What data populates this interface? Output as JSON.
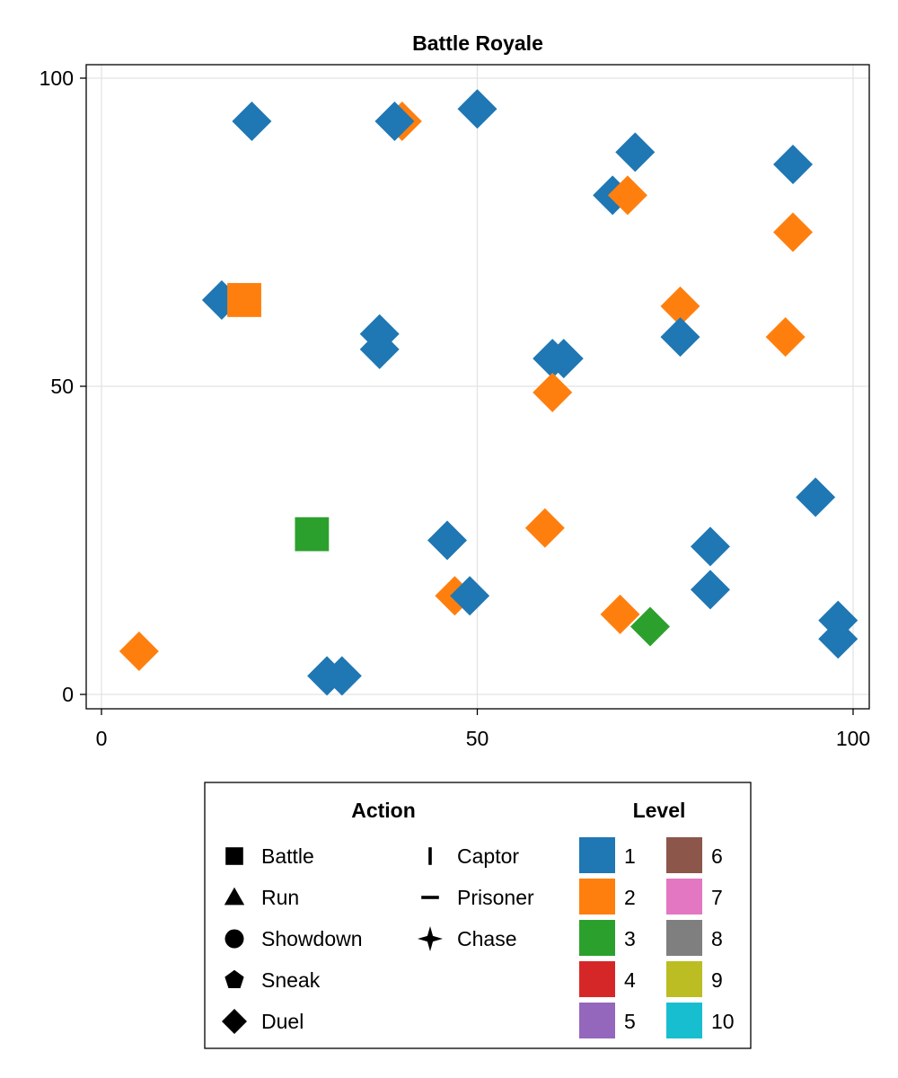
{
  "chart_data": {
    "type": "scatter",
    "title": "Battle Royale",
    "xlabel": "",
    "ylabel": "",
    "xlim": [
      -2,
      102
    ],
    "ylim": [
      -2.5,
      102
    ],
    "xticks": [
      0,
      50,
      100
    ],
    "yticks": [
      0,
      50,
      100
    ],
    "grid": true,
    "legend_placement": "bottom",
    "level_colors": {
      "1": "#1f77b4",
      "2": "#ff7f0e",
      "3": "#2ca02c",
      "4": "#d62728",
      "5": "#9467bd",
      "6": "#8c564b",
      "7": "#e377c2",
      "8": "#7f7f7f",
      "9": "#bcbd22",
      "10": "#17becf"
    },
    "points": [
      {
        "x": 40,
        "y": 93,
        "level": 2,
        "action": "Duel"
      },
      {
        "x": 20,
        "y": 93,
        "level": 1,
        "action": "Duel"
      },
      {
        "x": 39,
        "y": 93,
        "level": 1,
        "action": "Duel"
      },
      {
        "x": 50,
        "y": 95,
        "level": 1,
        "action": "Duel"
      },
      {
        "x": 71,
        "y": 88,
        "level": 1,
        "action": "Duel"
      },
      {
        "x": 92,
        "y": 86,
        "level": 1,
        "action": "Duel"
      },
      {
        "x": 68,
        "y": 81,
        "level": 1,
        "action": "Duel"
      },
      {
        "x": 70,
        "y": 81,
        "level": 2,
        "action": "Duel"
      },
      {
        "x": 92,
        "y": 75,
        "level": 2,
        "action": "Duel"
      },
      {
        "x": 16,
        "y": 64,
        "level": 1,
        "action": "Duel"
      },
      {
        "x": 19,
        "y": 64,
        "level": 2,
        "action": "Battle"
      },
      {
        "x": 37,
        "y": 58.5,
        "level": 1,
        "action": "Duel"
      },
      {
        "x": 37,
        "y": 56,
        "level": 1,
        "action": "Duel"
      },
      {
        "x": 77,
        "y": 63,
        "level": 2,
        "action": "Duel"
      },
      {
        "x": 77,
        "y": 58,
        "level": 1,
        "action": "Duel"
      },
      {
        "x": 91,
        "y": 58,
        "level": 2,
        "action": "Duel"
      },
      {
        "x": 61.5,
        "y": 54.5,
        "level": 1,
        "action": "Duel"
      },
      {
        "x": 60,
        "y": 54.5,
        "level": 1,
        "action": "Duel"
      },
      {
        "x": 60,
        "y": 49,
        "level": 2,
        "action": "Duel"
      },
      {
        "x": 95,
        "y": 32,
        "level": 1,
        "action": "Duel"
      },
      {
        "x": 28,
        "y": 26,
        "level": 3,
        "action": "Battle"
      },
      {
        "x": 59,
        "y": 27,
        "level": 2,
        "action": "Duel"
      },
      {
        "x": 46,
        "y": 25,
        "level": 1,
        "action": "Duel"
      },
      {
        "x": 81,
        "y": 24,
        "level": 1,
        "action": "Duel"
      },
      {
        "x": 47,
        "y": 16,
        "level": 2,
        "action": "Duel"
      },
      {
        "x": 49,
        "y": 16,
        "level": 1,
        "action": "Duel"
      },
      {
        "x": 81,
        "y": 17,
        "level": 1,
        "action": "Duel"
      },
      {
        "x": 69,
        "y": 13,
        "level": 2,
        "action": "Duel"
      },
      {
        "x": 73,
        "y": 11,
        "level": 3,
        "action": "Duel"
      },
      {
        "x": 98,
        "y": 12,
        "level": 1,
        "action": "Duel"
      },
      {
        "x": 98,
        "y": 9,
        "level": 1,
        "action": "Duel"
      },
      {
        "x": 5,
        "y": 7,
        "level": 2,
        "action": "Duel"
      },
      {
        "x": 30,
        "y": 3,
        "level": 1,
        "action": "Duel"
      },
      {
        "x": 32,
        "y": 3,
        "level": 1,
        "action": "Duel"
      }
    ],
    "legend": {
      "action_title": "Action",
      "actions": [
        {
          "label": "Battle",
          "marker": "square"
        },
        {
          "label": "Run",
          "marker": "triangle"
        },
        {
          "label": "Showdown",
          "marker": "circle"
        },
        {
          "label": "Sneak",
          "marker": "pentagon"
        },
        {
          "label": "Duel",
          "marker": "diamond"
        },
        {
          "label": "Captor",
          "marker": "vline"
        },
        {
          "label": "Prisoner",
          "marker": "hline"
        },
        {
          "label": "Chase",
          "marker": "star4"
        }
      ],
      "level_title": "Level",
      "levels": [
        "1",
        "2",
        "3",
        "4",
        "5",
        "6",
        "7",
        "8",
        "9",
        "10"
      ]
    }
  }
}
